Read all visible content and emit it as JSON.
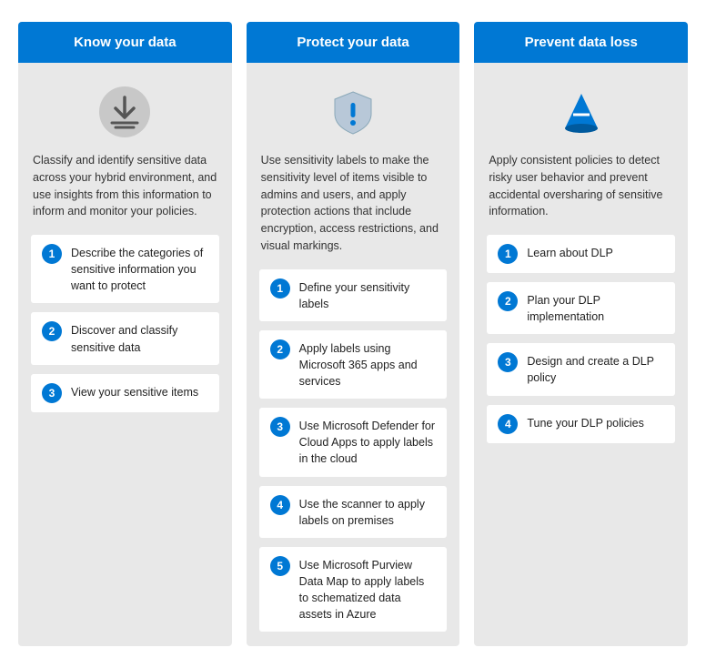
{
  "columns": [
    {
      "id": "know-your-data",
      "header": "Know your data",
      "description": "Classify and identify sensitive data across your hybrid environment, and use insights from this information to inform and monitor your policies.",
      "icon": "data-icon",
      "steps": [
        {
          "number": "1",
          "text": "Describe the categories of sensitive information you want to protect"
        },
        {
          "number": "2",
          "text": "Discover and classify sensitive data"
        },
        {
          "number": "3",
          "text": "View your sensitive items"
        }
      ]
    },
    {
      "id": "protect-your-data",
      "header": "Protect your data",
      "description": "Use sensitivity labels to make the sensitivity level of items visible to admins and users, and apply protection actions that include encryption, access restrictions, and visual markings.",
      "icon": "shield-icon",
      "steps": [
        {
          "number": "1",
          "text": "Define your sensitivity labels"
        },
        {
          "number": "2",
          "text": "Apply labels using Microsoft 365 apps and services"
        },
        {
          "number": "3",
          "text": "Use Microsoft Defender for Cloud Apps to apply labels in the cloud"
        },
        {
          "number": "4",
          "text": "Use the scanner to apply labels on premises"
        },
        {
          "number": "5",
          "text": "Use Microsoft Purview Data Map to apply labels to schematized data assets in Azure"
        }
      ]
    },
    {
      "id": "prevent-data-loss",
      "header": "Prevent data loss",
      "description": "Apply consistent policies to detect risky user behavior and prevent accidental oversharing of sensitive information.",
      "icon": "cone-icon",
      "steps": [
        {
          "number": "1",
          "text": "Learn about DLP"
        },
        {
          "number": "2",
          "text": "Plan your DLP implementation"
        },
        {
          "number": "3",
          "text": "Design and create a DLP policy"
        },
        {
          "number": "4",
          "text": "Tune your DLP policies"
        }
      ]
    }
  ]
}
